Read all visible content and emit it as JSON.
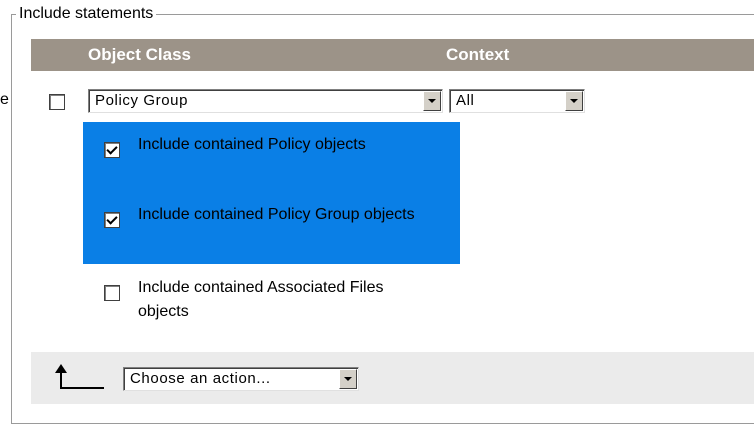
{
  "fieldset": {
    "legend": "Include statements",
    "edge_glyph": "e"
  },
  "table": {
    "columns": [
      {
        "label": "Object Class"
      },
      {
        "label": "Context"
      }
    ]
  },
  "row": {
    "selected": false,
    "object_class": {
      "value": "Policy Group"
    },
    "context": {
      "value": "All"
    }
  },
  "options": [
    {
      "label": "Include contained Policy objects",
      "checked": true,
      "highlighted": true
    },
    {
      "label": "Include contained Policy Group objects",
      "checked": true,
      "highlighted": true
    },
    {
      "label": "Include contained Associated Files objects",
      "checked": false,
      "highlighted": false
    }
  ],
  "action_bar": {
    "action_select": {
      "value": "Choose an action..."
    },
    "icon": "up-arrow-icon"
  },
  "colors": {
    "header_background": "#9c9388",
    "selection_highlight": "#0a7fe6",
    "action_bar_background": "#ebebeb",
    "frame_border": "#9a9a9a"
  }
}
